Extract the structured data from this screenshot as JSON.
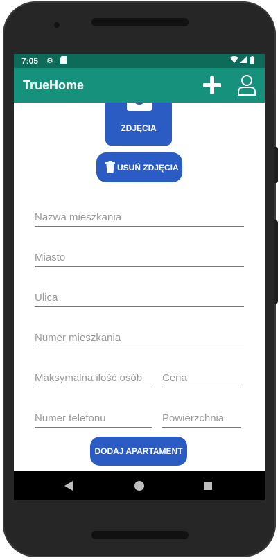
{
  "status_bar": {
    "time": "7:05",
    "icons": [
      "gear-icon",
      "sd-card-icon",
      "wifi-icon",
      "signal-icon",
      "battery-icon"
    ]
  },
  "app_bar": {
    "title": "TrueHome",
    "actions": [
      "add-icon",
      "user-icon"
    ]
  },
  "photo_button": {
    "label": "ZDJĘCIA",
    "icon": "camera-icon"
  },
  "remove_photos_button": {
    "label": "USUŃ ZDJĘCIA",
    "icon": "trash-icon"
  },
  "form": {
    "apartment_name": {
      "placeholder": "Nazwa mieszkania",
      "value": ""
    },
    "city": {
      "placeholder": "Miasto",
      "value": ""
    },
    "street": {
      "placeholder": "Ulica",
      "value": ""
    },
    "apartment_number": {
      "placeholder": "Numer mieszkania",
      "value": ""
    },
    "max_guests": {
      "placeholder": "Maksymalna ilość osób",
      "value": ""
    },
    "price": {
      "placeholder": "Cena",
      "value": ""
    },
    "phone": {
      "placeholder": "Numer telefonu",
      "value": ""
    },
    "area": {
      "placeholder": "Powierzchnia",
      "value": ""
    }
  },
  "submit_button": {
    "label": "DODAJ APARTAMENT"
  },
  "nav_bar": {
    "buttons": [
      "back-icon",
      "home-icon",
      "recents-icon"
    ]
  },
  "colors": {
    "status_bar": "#0e6b5a",
    "app_bar": "#16917c",
    "button": "#2b5cc3",
    "field_line": "#777777",
    "placeholder": "#9a9a9a"
  }
}
